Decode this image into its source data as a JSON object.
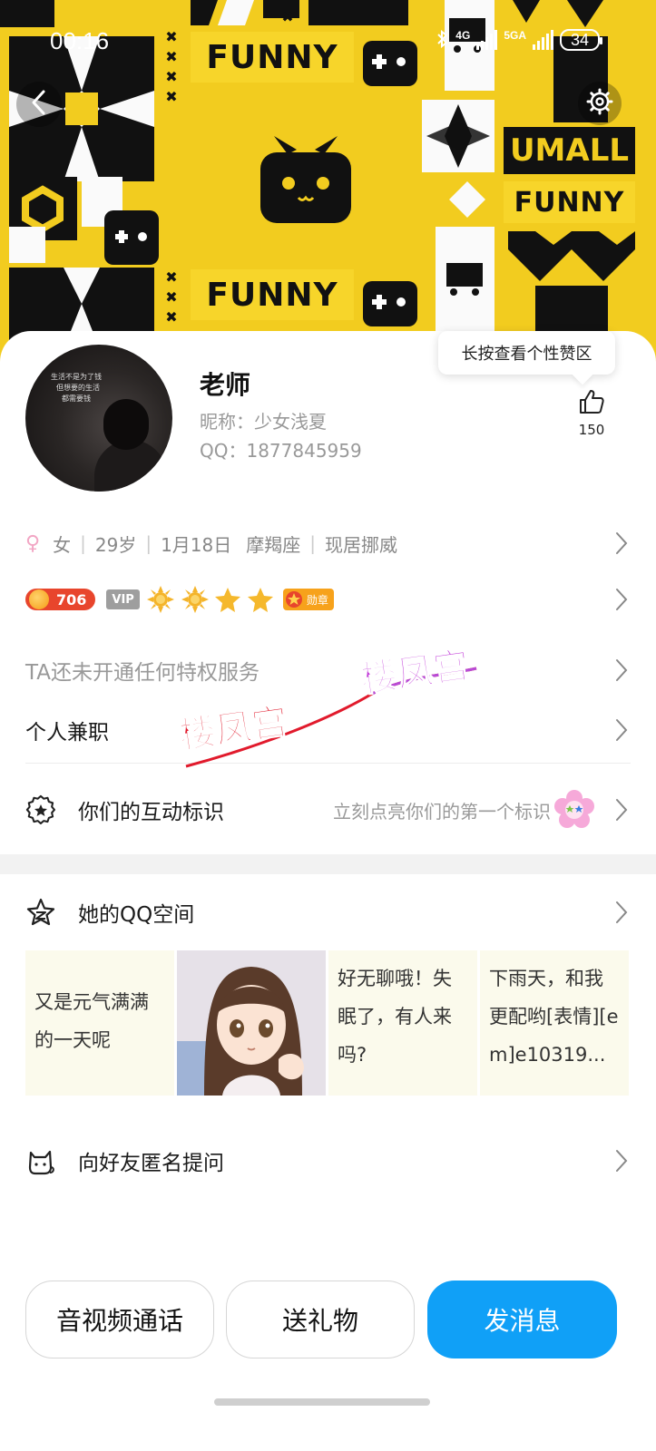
{
  "status_bar": {
    "time": "00:16",
    "net_label_1": "4G",
    "net_label_2": "5GA",
    "battery": "34"
  },
  "cover": {
    "banner_1": "FUNNY",
    "banner_2": "FUNNY",
    "banner_3": "FUNNY",
    "brand": "UMALL",
    "accent_color": "#f2cc1f"
  },
  "profile": {
    "name": "老师",
    "nickname": "昵称：少女浅夏",
    "qq": "QQ：1877845959",
    "avatar_quote": [
      "生活不是为了钱",
      "但想要的生活",
      "都需要钱"
    ],
    "like_tooltip": "长按查看个性赞区",
    "like_count": "150"
  },
  "info": {
    "gender": "女",
    "age": "29岁",
    "birthday": "1月18日",
    "zodiac": "摩羯座",
    "location": "现居挪威"
  },
  "badges": {
    "level": "706",
    "vip": "VIP",
    "medal": "勋章"
  },
  "rows": {
    "privilege": "TA还未开通任何特权服务",
    "job": "个人兼职",
    "interaction": "你们的互动标识",
    "interaction_hint": "立刻点亮你们的第一个标识",
    "qzone": "她的QQ空间",
    "ask": "向好友匿名提问"
  },
  "posts": [
    {
      "text": "又是元气满满的一天呢"
    },
    {
      "text": ""
    },
    {
      "text": "好无聊哦！失眠了，有人来吗?"
    },
    {
      "text": "下雨天，和我更配哟[表情][em]e10319..."
    }
  ],
  "buttons": {
    "call": "音视频通话",
    "gift": "送礼物",
    "message": "发消息",
    "primary_color": "#10a0f7"
  },
  "watermark": {
    "text_1": "楼凤宫",
    "text_2": "楼凤宫"
  }
}
